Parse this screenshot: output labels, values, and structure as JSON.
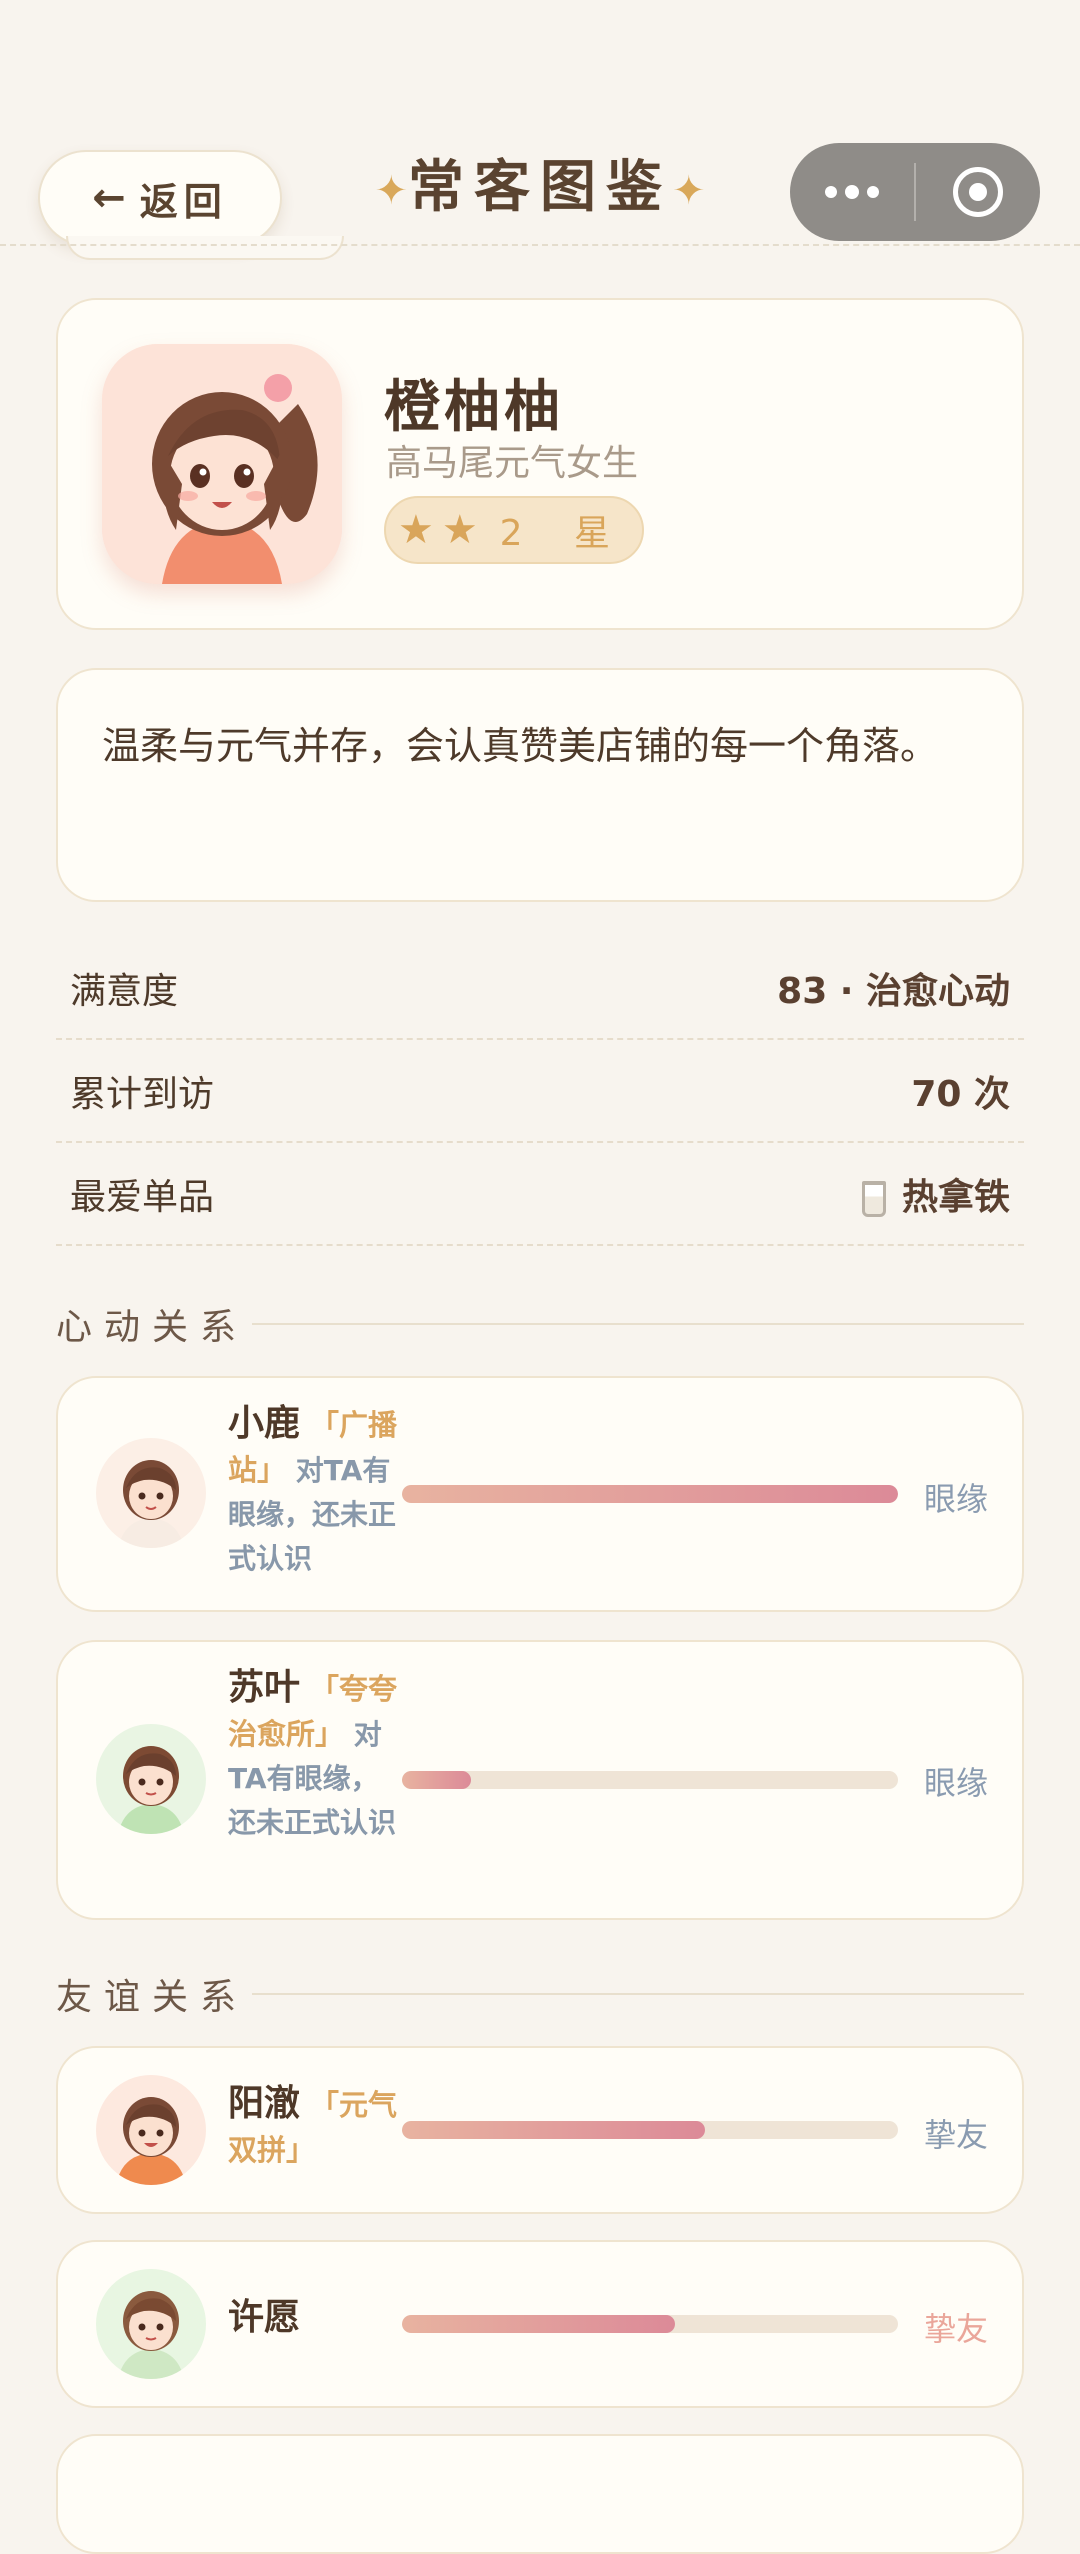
{
  "header": {
    "back_label": "返回",
    "back_arrow": "←",
    "title": "常客图鉴",
    "title_star": "✦"
  },
  "profile": {
    "name": "橙柚柚",
    "subtitle": "高马尾元气女生",
    "stars": 2,
    "star_glyph": "★",
    "star_label": "2 星",
    "avatar_icon": "girl-ponytail-avatar"
  },
  "description": "温柔与元气并存，会认真赞美店铺的每一个角落。",
  "stats": [
    {
      "label": "满意度",
      "value": "83 · 治愈心动"
    },
    {
      "label": "累计到访",
      "value": "70 次"
    },
    {
      "label": "最爱单品",
      "value": "热拿铁",
      "icon": "coffee-cup-icon"
    }
  ],
  "sections": {
    "heart": "心动关系",
    "friend": "友谊关系"
  },
  "heart_relations": [
    {
      "name": "小鹿",
      "station": "「广播站」",
      "desc": "对TA有眼缘，还未正式认识",
      "progress": 1.0,
      "level": "眼缘"
    },
    {
      "name": "苏叶",
      "station": "「夸夸治愈所」",
      "desc": "对TA有眼缘，还未正式认识",
      "progress": 0.14,
      "level": "眼缘"
    }
  ],
  "friend_relations": [
    {
      "name": "阳澈",
      "station": "「元气双拼」",
      "desc": "",
      "progress": 0.61,
      "level": "挚友"
    },
    {
      "name": "许愿",
      "station": "",
      "desc": "",
      "progress": 0.55,
      "level": "挚友"
    }
  ],
  "colors": {
    "background": "#f8f4ee",
    "card": "#fffdf7",
    "accent_gold": "#d9a55a",
    "bar_start": "#e8b3a0",
    "bar_end": "#dc8a98",
    "level_blue": "#8a9bb0",
    "level_pink": "#eaa69a"
  }
}
